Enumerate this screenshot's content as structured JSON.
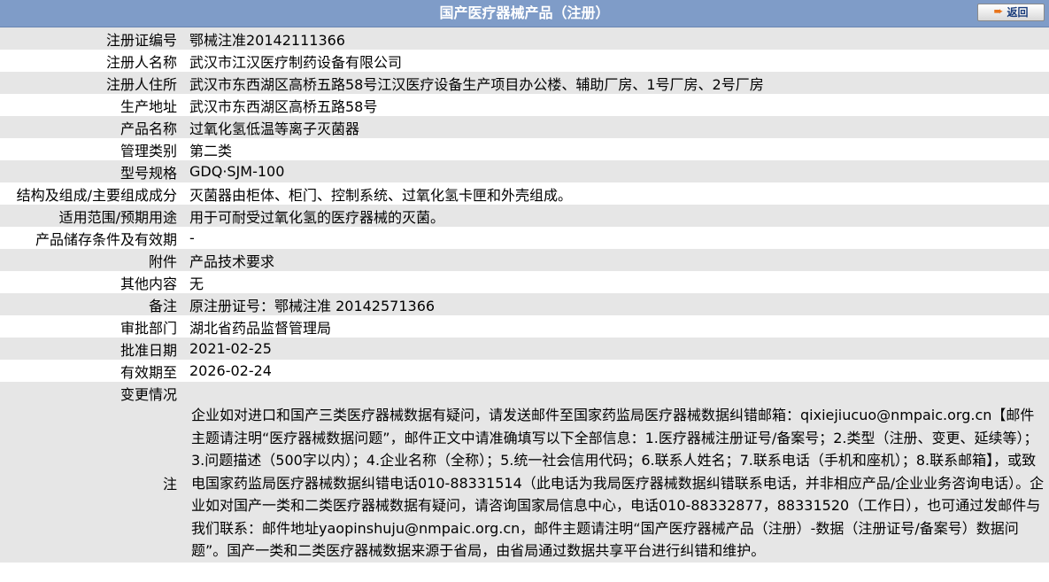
{
  "header": {
    "title": "国产医疗器械产品（注册）",
    "back_label": "返回"
  },
  "rows": [
    {
      "label": "注册证编号",
      "value": "鄂械注准20142111366"
    },
    {
      "label": "注册人名称",
      "value": "武汉市江汉医疗制药设备有限公司"
    },
    {
      "label": "注册人住所",
      "value": "武汉市东西湖区高桥五路58号江汉医疗设备生产项目办公楼、辅助厂房、1号厂房、2号厂房"
    },
    {
      "label": "生产地址",
      "value": "武汉市东西湖区高桥五路58号"
    },
    {
      "label": "产品名称",
      "value": "过氧化氢低温等离子灭菌器"
    },
    {
      "label": "管理类别",
      "value": "第二类"
    },
    {
      "label": "型号规格",
      "value": "GDQ·SJM-100"
    },
    {
      "label": "结构及组成/主要组成成分",
      "value": "灭菌器由柜体、柜门、控制系统、过氧化氢卡匣和外壳组成。"
    },
    {
      "label": "适用范围/预期用途",
      "value": "用于可耐受过氧化氢的医疗器械的灭菌。"
    },
    {
      "label": "产品储存条件及有效期",
      "value": "-"
    },
    {
      "label": "附件",
      "value": "产品技术要求"
    },
    {
      "label": "其他内容",
      "value": "无"
    },
    {
      "label": "备注",
      "value": "原注册证号：鄂械注准 20142571366"
    },
    {
      "label": "审批部门",
      "value": "湖北省药品监督管理局"
    },
    {
      "label": "批准日期",
      "value": "2021-02-25"
    },
    {
      "label": "有效期至",
      "value": "2026-02-24"
    },
    {
      "label": "变更情况",
      "value": ""
    }
  ],
  "note": {
    "label": "注",
    "text": "企业如对进口和国产三类医疗器械数据有疑问，请发送邮件至国家药监局医疗器械数据纠错邮箱：qixiejiucuo@nmpaic.org.cn【邮件主题请注明“医疗器械数据问题”，邮件正文中请准确填写以下全部信息：1.医疗器械注册证号/备案号；2.类型（注册、变更、延续等）；3.问题描述（500字以内）；4.企业名称（全称）；5.统一社会信用代码；6.联系人姓名；7.联系电话（手机和座机）；8.联系邮箱】，或致电国家药监局医疗器械数据纠错电话010-88331514（此电话为我局医疗器械数据纠错联系电话，并非相应产品/企业业务咨询电话）。企业如对国产一类和二类医疗器械数据有疑问，请咨询国家局信息中心，电话010-88332877，88331520（工作日），也可通过发邮件与我们联系：邮件地址yaopinshuju@nmpaic.org.cn，邮件主题请注明“国产医疗器械产品（注册）-数据（注册证号/备案号）数据问题”。国产一类和二类医疗器械数据来源于省局，由省局通过数据共享平台进行纠错和维护。"
  }
}
